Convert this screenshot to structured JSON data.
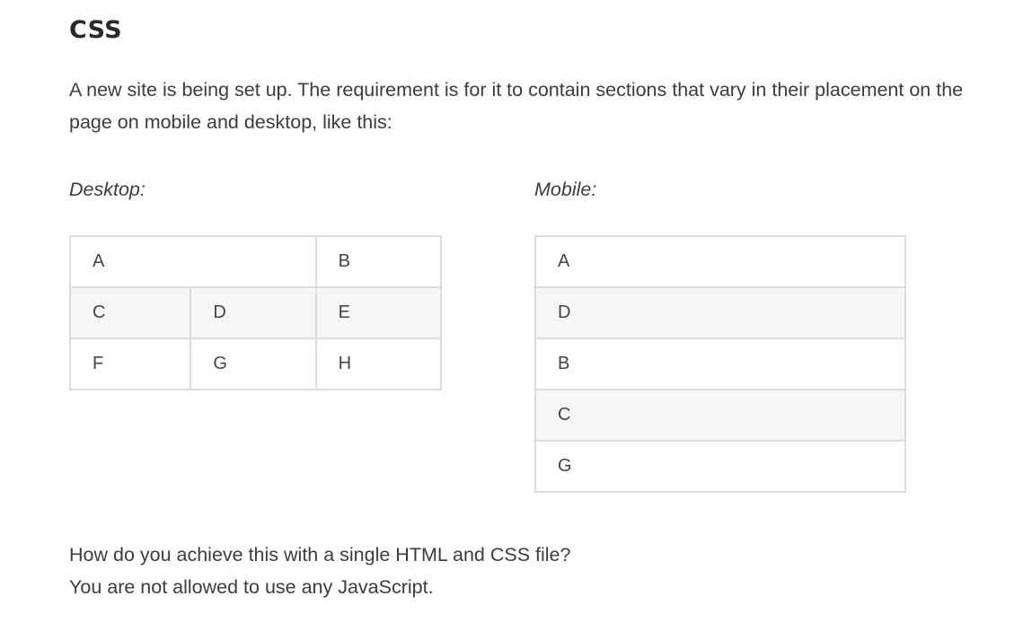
{
  "heading": "CSS",
  "intro": "A new site is being set up. The requirement is for it to contain sections that vary in their placement on the page on mobile and desktop, like this:",
  "desktop": {
    "caption": "Desktop:",
    "rows": [
      [
        "A",
        "",
        "B"
      ],
      [
        "C",
        "D",
        "E"
      ],
      [
        "F",
        "G",
        "H"
      ]
    ]
  },
  "mobile": {
    "caption": "Mobile:",
    "rows": [
      "A",
      "D",
      "B",
      "C",
      "G"
    ]
  },
  "outro": {
    "line1": "How do you achieve this with a single HTML and CSS file?",
    "line2": "You are not allowed to use any JavaScript."
  }
}
